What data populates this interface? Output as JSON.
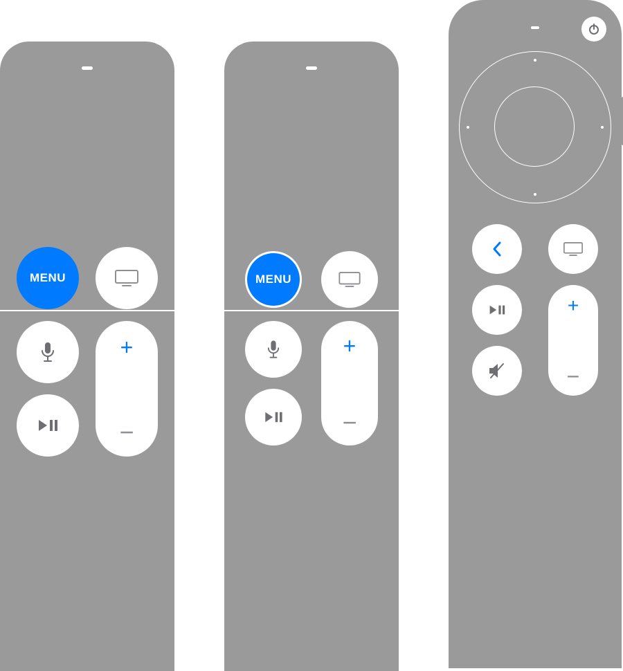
{
  "accent_color": "#007aff",
  "body_color": "#9a9a9a",
  "button_color": "#ffffff",
  "glyph_gray": "#8e8e93",
  "remotes": {
    "gen1": {
      "menu_label": "MENU",
      "buttons": [
        "menu",
        "tv",
        "mic",
        "play-pause",
        "volume-up",
        "volume-down"
      ]
    },
    "gen2": {
      "menu_label": "MENU",
      "buttons": [
        "menu",
        "tv",
        "mic",
        "play-pause",
        "volume-up",
        "volume-down"
      ]
    },
    "gen3": {
      "buttons": [
        "power",
        "clickpad",
        "back",
        "tv",
        "play-pause",
        "mute",
        "volume-up",
        "volume-down"
      ]
    }
  },
  "volume": {
    "plus": "+",
    "minus": "−"
  }
}
